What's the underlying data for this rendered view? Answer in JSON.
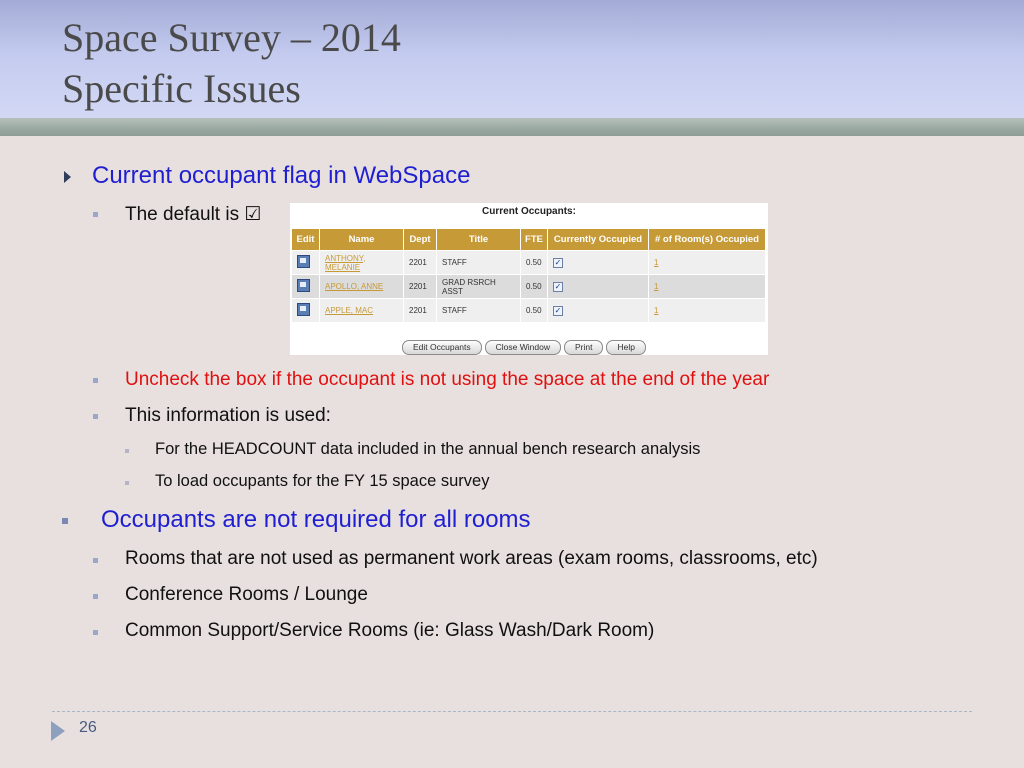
{
  "title": {
    "line1": "Space Survey – 2014",
    "line2": "Specific Issues"
  },
  "bullets": {
    "b1": "Current occupant flag in WebSpace",
    "b1_default": "The default is ☑",
    "b1_uncheck": "Uncheck the box if the occupant is not using the space at the end of the year",
    "b1_info": "This information is used:",
    "b1_info_1": "For the HEADCOUNT data included in the annual bench research analysis",
    "b1_info_2": "To load occupants for the FY 15 space survey",
    "b2": "Occupants are not required for all rooms",
    "b2_1": "Rooms that are not used as permanent work areas (exam rooms, classrooms, etc)",
    "b2_2": "Conference Rooms / Lounge",
    "b2_3": "Common Support/Service Rooms (ie: Glass Wash/Dark Room)"
  },
  "screenshot": {
    "title": "Current Occupants:",
    "columns": [
      "Edit",
      "Name",
      "Dept",
      "Title",
      "FTE",
      "Currently Occupied",
      "# of Room(s) Occupied"
    ],
    "rows": [
      {
        "name": "ANTHONY, MELANIE",
        "dept": "2201",
        "title": "STAFF",
        "fte": "0.50",
        "occupied": "✓",
        "rooms": "1"
      },
      {
        "name": "APOLLO, ANNE",
        "dept": "2201",
        "title": "GRAD RSRCH ASST",
        "fte": "0.50",
        "occupied": "✓",
        "rooms": "1"
      },
      {
        "name": "APPLE, MAC",
        "dept": "2201",
        "title": "STAFF",
        "fte": "0.50",
        "occupied": "✓",
        "rooms": "1"
      }
    ],
    "buttons": {
      "edit": "Edit Occupants",
      "close": "Close Window",
      "print": "Print",
      "help": "Help"
    }
  },
  "footer": {
    "page": "26"
  }
}
